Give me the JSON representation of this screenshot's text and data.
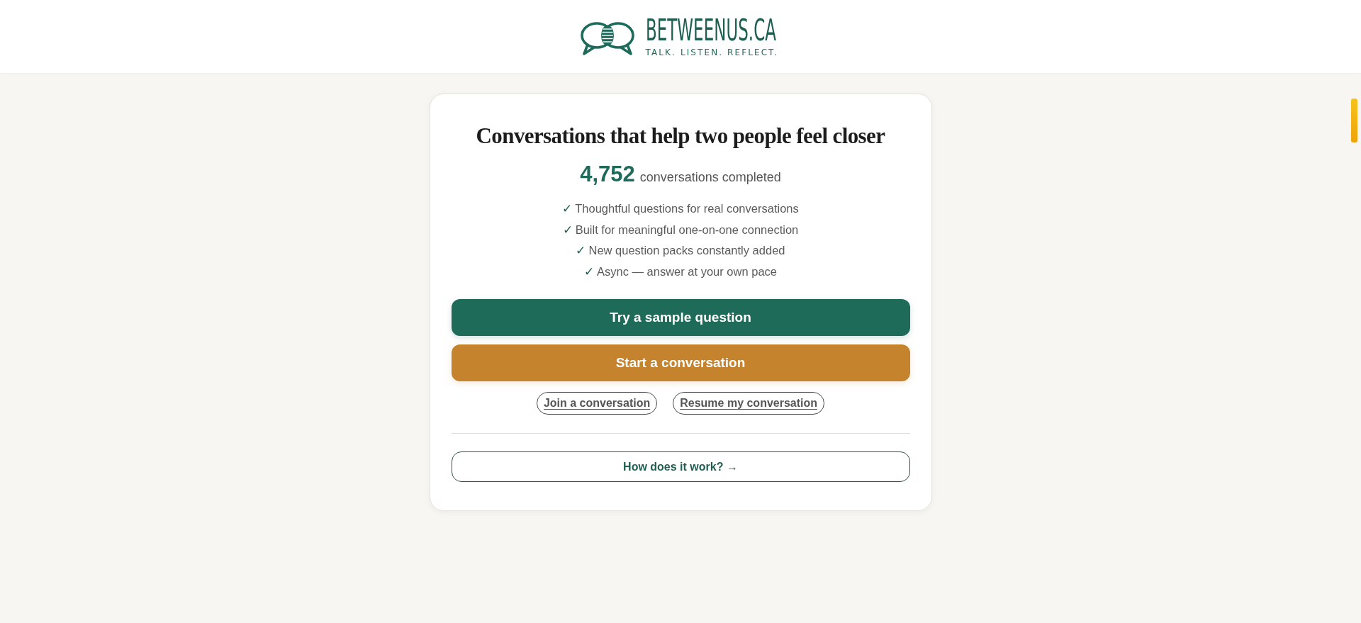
{
  "header": {
    "logo": {
      "name": "BETWEENUS.CA",
      "tagline": "TALK. LISTEN. REFLECT."
    }
  },
  "card": {
    "title": "Conversations that help two people feel closer",
    "stat": {
      "value": "4,752",
      "label": "conversations completed"
    },
    "features": [
      {
        "mark": "✓",
        "text": "Thoughtful questions for real conversations"
      },
      {
        "mark": "✓",
        "text": "Built for meaningful one-on-one connection"
      },
      {
        "mark": "✓",
        "text": "New question packs constantly added"
      },
      {
        "mark": "✓",
        "text": "Async — answer at your own pace"
      }
    ],
    "actions": [
      {
        "kind": "primary",
        "label": "Try a sample question"
      },
      {
        "kind": "accent",
        "label": "Start a conversation"
      }
    ],
    "links": [
      {
        "label": "Join a conversation"
      },
      {
        "label": "Resume my conversation"
      }
    ],
    "secondary": {
      "label": "How does it work? →"
    }
  }
}
